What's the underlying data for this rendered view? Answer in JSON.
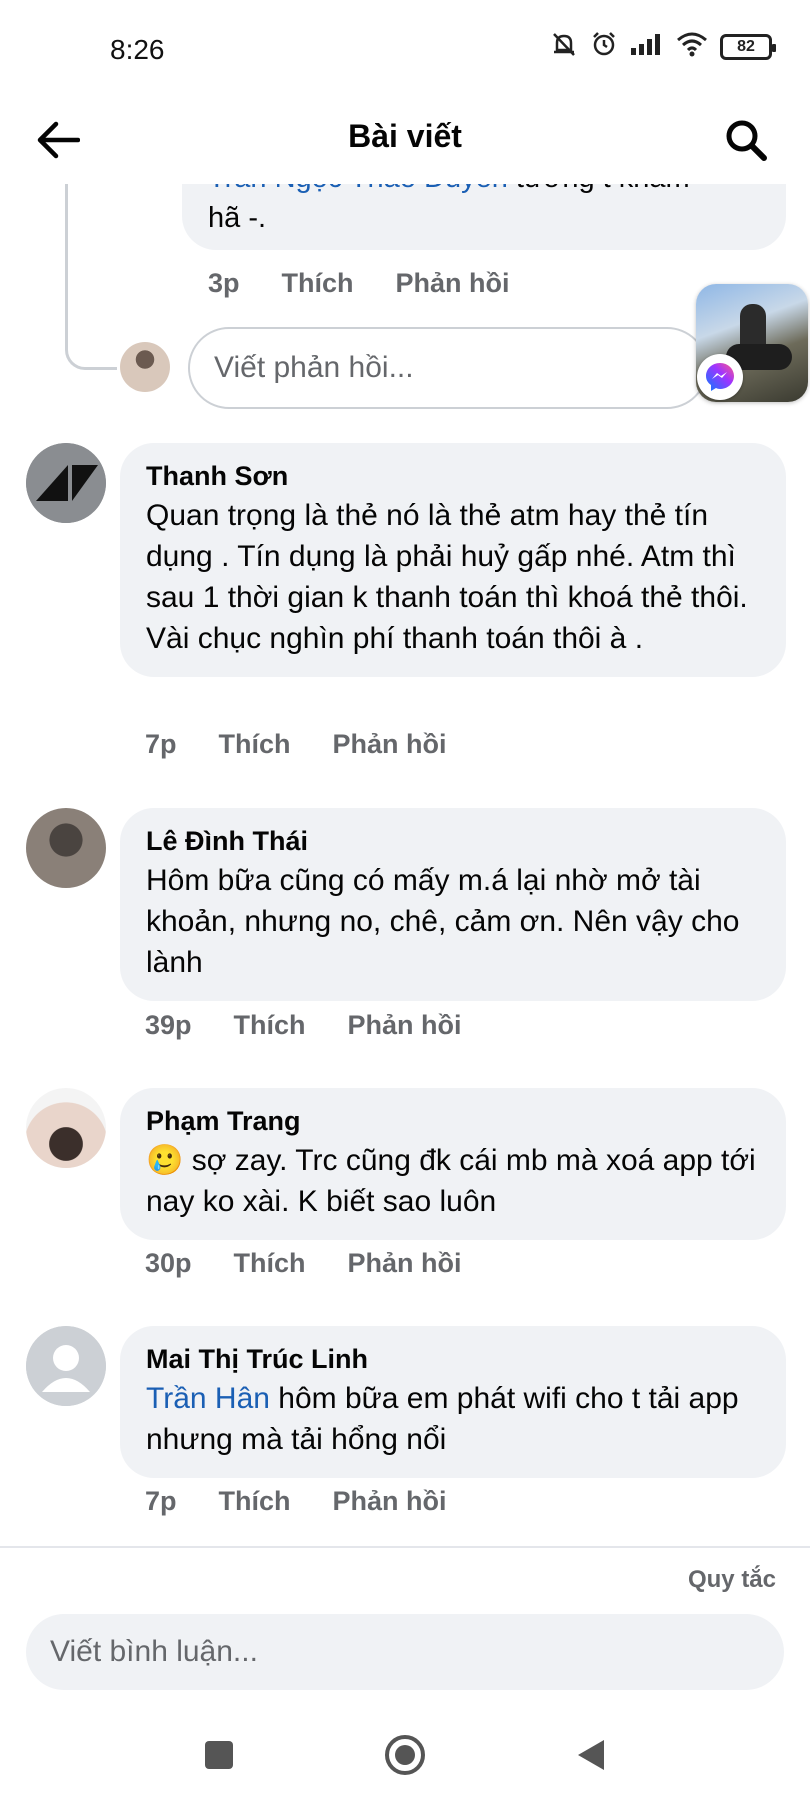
{
  "status_bar": {
    "time": "8:26",
    "battery": "82",
    "icons": [
      "mute-bell-icon",
      "alarm-icon",
      "signal-icon",
      "wifi-icon",
      "battery-icon"
    ]
  },
  "header": {
    "title": "Bài viết",
    "back_icon": "back-arrow-icon",
    "search_icon": "search-icon"
  },
  "colors": {
    "mention": "#1a5fb4",
    "bubble": "#f0f2f5",
    "muted": "#65676b",
    "text": "#050505"
  },
  "reply_thread": {
    "partial_mention": "Trần Ngọc Thảo Duyên",
    "partial_text_after": " tưởng t khám",
    "partial_line2": "hã -.",
    "time": "3p",
    "like": "Thích",
    "reply": "Phản hồi",
    "reply_placeholder": "Viết phản hồi..."
  },
  "comments": [
    {
      "author": "Thanh Sơn",
      "text": "Quan trọng là thẻ nó là thẻ atm hay thẻ tín dụng . Tín dụng là phải huỷ gấp nhé. Atm thì sau 1 thời gian k thanh toán thì khoá thẻ thôi. Vài chục nghìn phí thanh toán thôi à .",
      "time": "7p",
      "like": "Thích",
      "reply": "Phản hồi"
    },
    {
      "author": "Lê Đình Thái",
      "text": "Hôm bữa cũng có mấy m.á lại nhờ mở tài khoản, nhưng no, chê, cảm ơn. Nên vậy cho lành",
      "time": "39p",
      "like": "Thích",
      "reply": "Phản hồi"
    },
    {
      "author": "Phạm Trang",
      "emoji": "🥲",
      "text": " sợ zay. Trc cũng đk cái mb mà xoá app tới nay ko xài. K biết sao luôn",
      "time": "30p",
      "like": "Thích",
      "reply": "Phản hồi"
    },
    {
      "author": "Mai Thị Trúc Linh",
      "mention": "Trần Hân",
      "text": " hôm bữa em phát wifi cho t tải app nhưng mà tải hổng nổi",
      "time": "7p",
      "like": "Thích",
      "reply": "Phản hồi"
    }
  ],
  "footer": {
    "rules": "Quy tắc",
    "comment_placeholder": "Viết bình luận..."
  },
  "nav_bar": {
    "icons": [
      "recents-square-icon",
      "home-circle-icon",
      "back-triangle-icon"
    ]
  }
}
